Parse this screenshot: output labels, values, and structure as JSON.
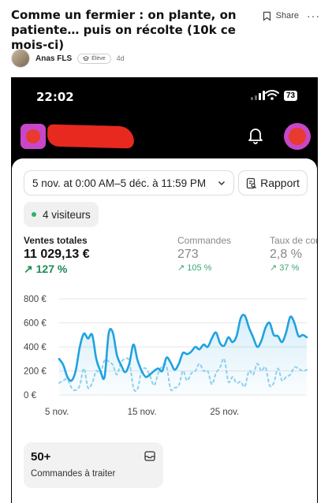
{
  "post": {
    "title": "Comme un fermier : on plante, on patiente… puis on récolte (10k ce mois-ci)",
    "share_label": "Share",
    "more_label": "···",
    "author": "Anas FLS",
    "badge": "Élève",
    "time_ago": "4d"
  },
  "phone": {
    "clock": "22:02",
    "battery": "73"
  },
  "dashboard": {
    "date_range": "5 nov. at 0:00 AM–5 déc. à 11:59 PM",
    "report_label": "Rapport",
    "visitors": "4 visiteurs",
    "metrics": [
      {
        "label": "Ventes totales",
        "value": "11 029,13 €",
        "delta": "↗ 127 %"
      },
      {
        "label": "Commandes",
        "value": "273",
        "delta": "↗ 105 %"
      },
      {
        "label": "Taux de conversion",
        "value": "2,8 %",
        "delta": "↗ 37 %"
      }
    ],
    "orders_card": {
      "count": "50+",
      "label": "Commandes à traiter"
    }
  },
  "colors": {
    "current_line": "#1fa2e0",
    "previous_line": "#8cd0ef",
    "positive": "#1e8a55",
    "brand": "#c847c8",
    "redaction": "#e8291f"
  },
  "chart_data": {
    "type": "line",
    "y_ticks": [
      "800 €",
      "600 €",
      "400 €",
      "200 €",
      "0 €"
    ],
    "x_ticks": [
      "5 nov.",
      "15 nov.",
      "25 nov."
    ],
    "ylim": [
      0,
      800
    ],
    "grid": true,
    "x": [
      1,
      2,
      3,
      4,
      5,
      6,
      7,
      8,
      9,
      10,
      11,
      12,
      13,
      14,
      15,
      16,
      17,
      18,
      19,
      20,
      21,
      22,
      23,
      24,
      25,
      26,
      27,
      28,
      29,
      30,
      31,
      32,
      33,
      34,
      35,
      36,
      37,
      38,
      39,
      40,
      41,
      42,
      43,
      44,
      45,
      46,
      47,
      48,
      49,
      50,
      51,
      52,
      53,
      54,
      55,
      56,
      57,
      58,
      59,
      60,
      61
    ],
    "series": [
      {
        "style": "solid",
        "values": [
          300,
          250,
          150,
          120,
          200,
          400,
          510,
          470,
          500,
          300,
          200,
          150,
          510,
          520,
          330,
          250,
          190,
          260,
          420,
          290,
          200,
          150,
          170,
          200,
          220,
          200,
          310,
          270,
          210,
          260,
          350,
          340,
          360,
          400,
          380,
          420,
          400,
          470,
          520,
          430,
          410,
          480,
          440,
          490,
          640,
          660,
          560,
          480,
          400,
          450,
          560,
          600,
          500,
          490,
          440,
          520,
          650,
          600,
          490,
          500,
          480
        ]
      },
      {
        "style": "dashed",
        "values": [
          100,
          120,
          130,
          60,
          40,
          80,
          220,
          60,
          100,
          200,
          180,
          290,
          280,
          250,
          170,
          270,
          300,
          280,
          60,
          50,
          200,
          220,
          160,
          80,
          180,
          240,
          240,
          50,
          60,
          80,
          200,
          120,
          180,
          200,
          260,
          200,
          200,
          90,
          180,
          230,
          300,
          110,
          150,
          100,
          110,
          70,
          200,
          170,
          260,
          200,
          230,
          80,
          100,
          220,
          120,
          150,
          170,
          230,
          220,
          200,
          210
        ]
      }
    ]
  }
}
